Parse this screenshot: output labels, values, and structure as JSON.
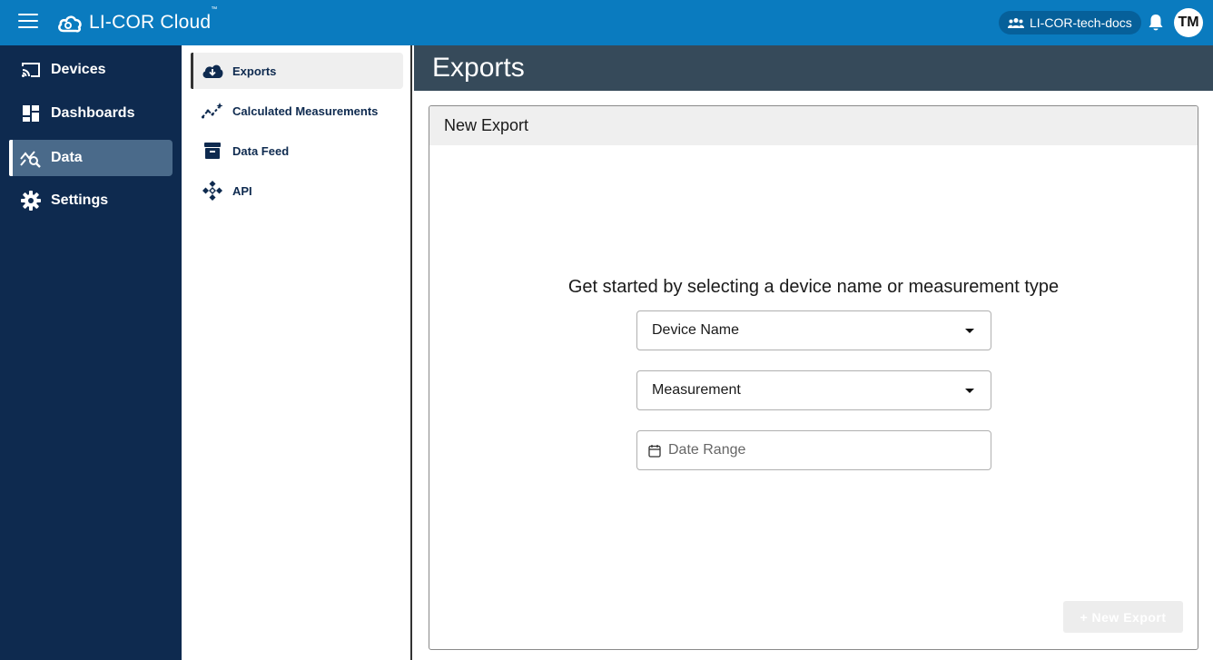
{
  "app": {
    "logo_text": "LI-COR Cloud",
    "logo_tm": "™"
  },
  "topbar": {
    "org_name": "LI-COR-tech-docs",
    "avatar_initials": "TM"
  },
  "leftnav": {
    "items": [
      {
        "label": "Devices",
        "icon": "cast-icon"
      },
      {
        "label": "Dashboards",
        "icon": "dashboard-icon"
      },
      {
        "label": "Data",
        "icon": "data-search-icon"
      },
      {
        "label": "Settings",
        "icon": "gear-icon"
      }
    ],
    "active": "Data"
  },
  "subnav": {
    "items": [
      {
        "label": "Exports",
        "icon": "cloud-download-icon"
      },
      {
        "label": "Calculated Measurements",
        "icon": "sparkle-chart-icon"
      },
      {
        "label": "Data Feed",
        "icon": "archive-icon"
      },
      {
        "label": "API",
        "icon": "api-icon"
      }
    ],
    "active": "Exports"
  },
  "main": {
    "page_title": "Exports",
    "card_title": "New Export",
    "prompt": "Get started by selecting a device name or measurement type",
    "device_select": "Device Name",
    "measurement_select": "Measurement",
    "date_range_placeholder": "Date Range",
    "new_export_button": "+ New Export"
  },
  "colors": {
    "topbar": "#0a7bbf",
    "leftnav": "#0e2a4f",
    "page_header": "#364a5a",
    "active_nav": "#4a6a8a"
  }
}
